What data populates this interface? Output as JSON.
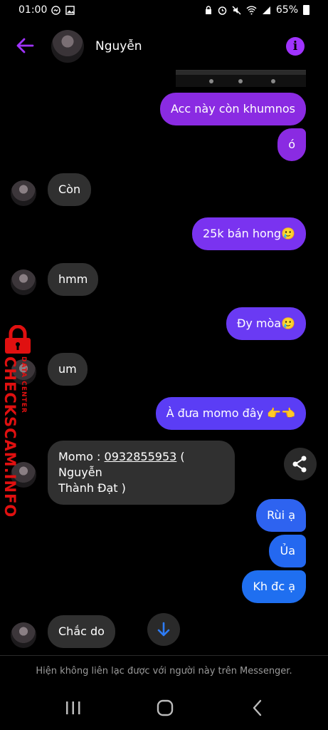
{
  "status_bar": {
    "time": "01:00",
    "battery": "65%"
  },
  "header": {
    "contact_name": "Nguyễn"
  },
  "messages": {
    "m1": "Acc này còn khumnos",
    "m2": "ó",
    "m3": "Còn",
    "m4": "25k bán hong🥲",
    "m5": "hmm",
    "m6": "Đy mòa🥲",
    "m7": "um",
    "m8": "À đưa momo đây 👉👈",
    "m9_prefix": "Momo : ",
    "m9_phone": "0932855953",
    "m9_suffix": " ( Nguyễn",
    "m9_line2": "Thành Đạt )",
    "m10": "Rùi ạ",
    "m11": "Ủa",
    "m12": "Kh đc ạ",
    "m13": "Chắc do"
  },
  "footer": {
    "notice": "Hiện không liên lạc được với người này trên Messenger."
  },
  "watermark": {
    "brand": "CHECKSCAM.INFO",
    "sub": "DATA CENTER"
  },
  "colors": {
    "purple": "#8a2be2",
    "violet": "#a033ff",
    "indigo": "#5b3df5",
    "blue": "#1f6ff0",
    "incoming": "#303030",
    "watermark_red": "#e01010"
  }
}
